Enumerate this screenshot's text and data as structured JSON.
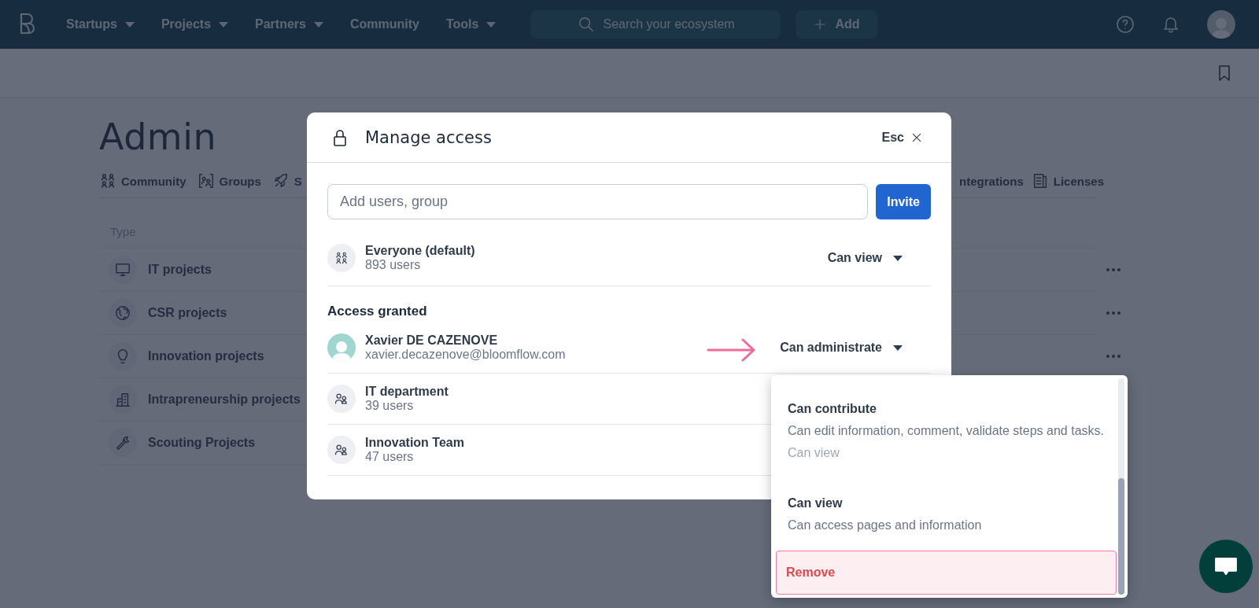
{
  "nav": {
    "menu": [
      {
        "label": "Startups",
        "has_menu": true
      },
      {
        "label": "Projects",
        "has_menu": true
      },
      {
        "label": "Partners",
        "has_menu": true
      },
      {
        "label": "Community",
        "has_menu": false
      },
      {
        "label": "Tools",
        "has_menu": true
      }
    ],
    "search": {
      "placeholder": "Search your ecosystem"
    },
    "add_button": "Add"
  },
  "page": {
    "title": "Admin",
    "tabs": [
      {
        "label": "Community"
      },
      {
        "label": "Groups"
      },
      {
        "label": "S"
      },
      {
        "label": "ntegrations"
      },
      {
        "label": "Licenses"
      }
    ],
    "table": {
      "columns": [
        "Type"
      ],
      "rows": [
        {
          "name": "IT projects"
        },
        {
          "name": "CSR projects"
        },
        {
          "name": "Innovation projects"
        },
        {
          "name": "Intrapreneurship projects"
        },
        {
          "name": "Scouting Projects"
        }
      ]
    }
  },
  "modal": {
    "title": "Manage access",
    "close": "Esc",
    "input": {
      "placeholder": "Add users, group"
    },
    "invite_button": "Invite",
    "default_member": {
      "kind": "everyone",
      "name": "Everyone (default)",
      "detail": "893 users",
      "role": "Can view"
    },
    "section_title": "Access granted",
    "members": [
      {
        "kind": "person",
        "name": "Xavier DE CAZENOVE",
        "detail": "xavier.decazenove@bloomflow.com",
        "role": "Can administrate"
      },
      {
        "kind": "group",
        "name": "IT department",
        "detail": "39 users"
      },
      {
        "kind": "group",
        "name": "Innovation Team",
        "detail": "47 users"
      }
    ]
  },
  "role_menu": {
    "items": [
      {
        "kind": "option",
        "title": "Can contribute",
        "description": "Can edit information, comment, validate steps and tasks.",
        "note": "Can view",
        "hovered": false
      },
      {
        "kind": "option",
        "title": "Can view",
        "description": "Can access pages and information",
        "hovered": false
      },
      {
        "kind": "danger",
        "title": "Remove",
        "hovered": true
      }
    ]
  }
}
